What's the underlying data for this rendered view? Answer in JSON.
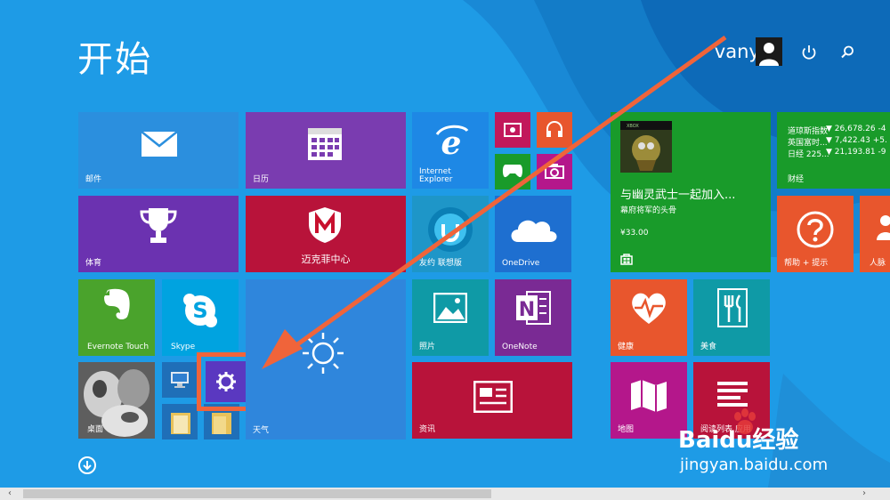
{
  "start_title": "开始",
  "user": {
    "name": "vanyan"
  },
  "tiles": {
    "mail": "邮件",
    "calendar": "日历",
    "ie": "Internet Explorer",
    "ie_line1": "Internet",
    "ie_line2": "Explorer",
    "sports": "体育",
    "mcafee": "迈克菲中心",
    "youni": "友约 联想版",
    "onedrive": "OneDrive",
    "evernote": "Evernote Touch",
    "skype": "Skype",
    "weather": "天气",
    "photos": "照片",
    "onenote": "OneNote",
    "desktop": "桌面",
    "news": "资讯",
    "health": "健康",
    "food": "美食",
    "maps": "地图",
    "reading": "阅读列表 应用",
    "help": "帮助 + 提示",
    "people": "人脉",
    "finance": "财经"
  },
  "xbox_tile": {
    "badge": "XBOX",
    "title": "与幽灵武士一起加入...",
    "subtitle": "幕府将军的头骨",
    "price": "¥33.00"
  },
  "finance_rows": [
    {
      "name": "道琼斯指数",
      "value": "▼ 26,678.26 -4"
    },
    {
      "name": "英国富时...",
      "value": "▼ 7,422.43 +5."
    },
    {
      "name": "日经 225...",
      "value": "▼ 21,193.81 -9"
    }
  ],
  "watermark": {
    "brand": "Baidu经验",
    "url": "jingyan.baidu.com"
  },
  "colors": {
    "background": "#1e9be6",
    "annotation": "#f0643a",
    "tile_blue": "#2b8fde",
    "tile_purple": "#7a3cb0",
    "tile_red": "#b8133a",
    "tile_green": "#199b2a",
    "tile_orange": "#e8562d",
    "tile_teal": "#0f9aa6"
  }
}
